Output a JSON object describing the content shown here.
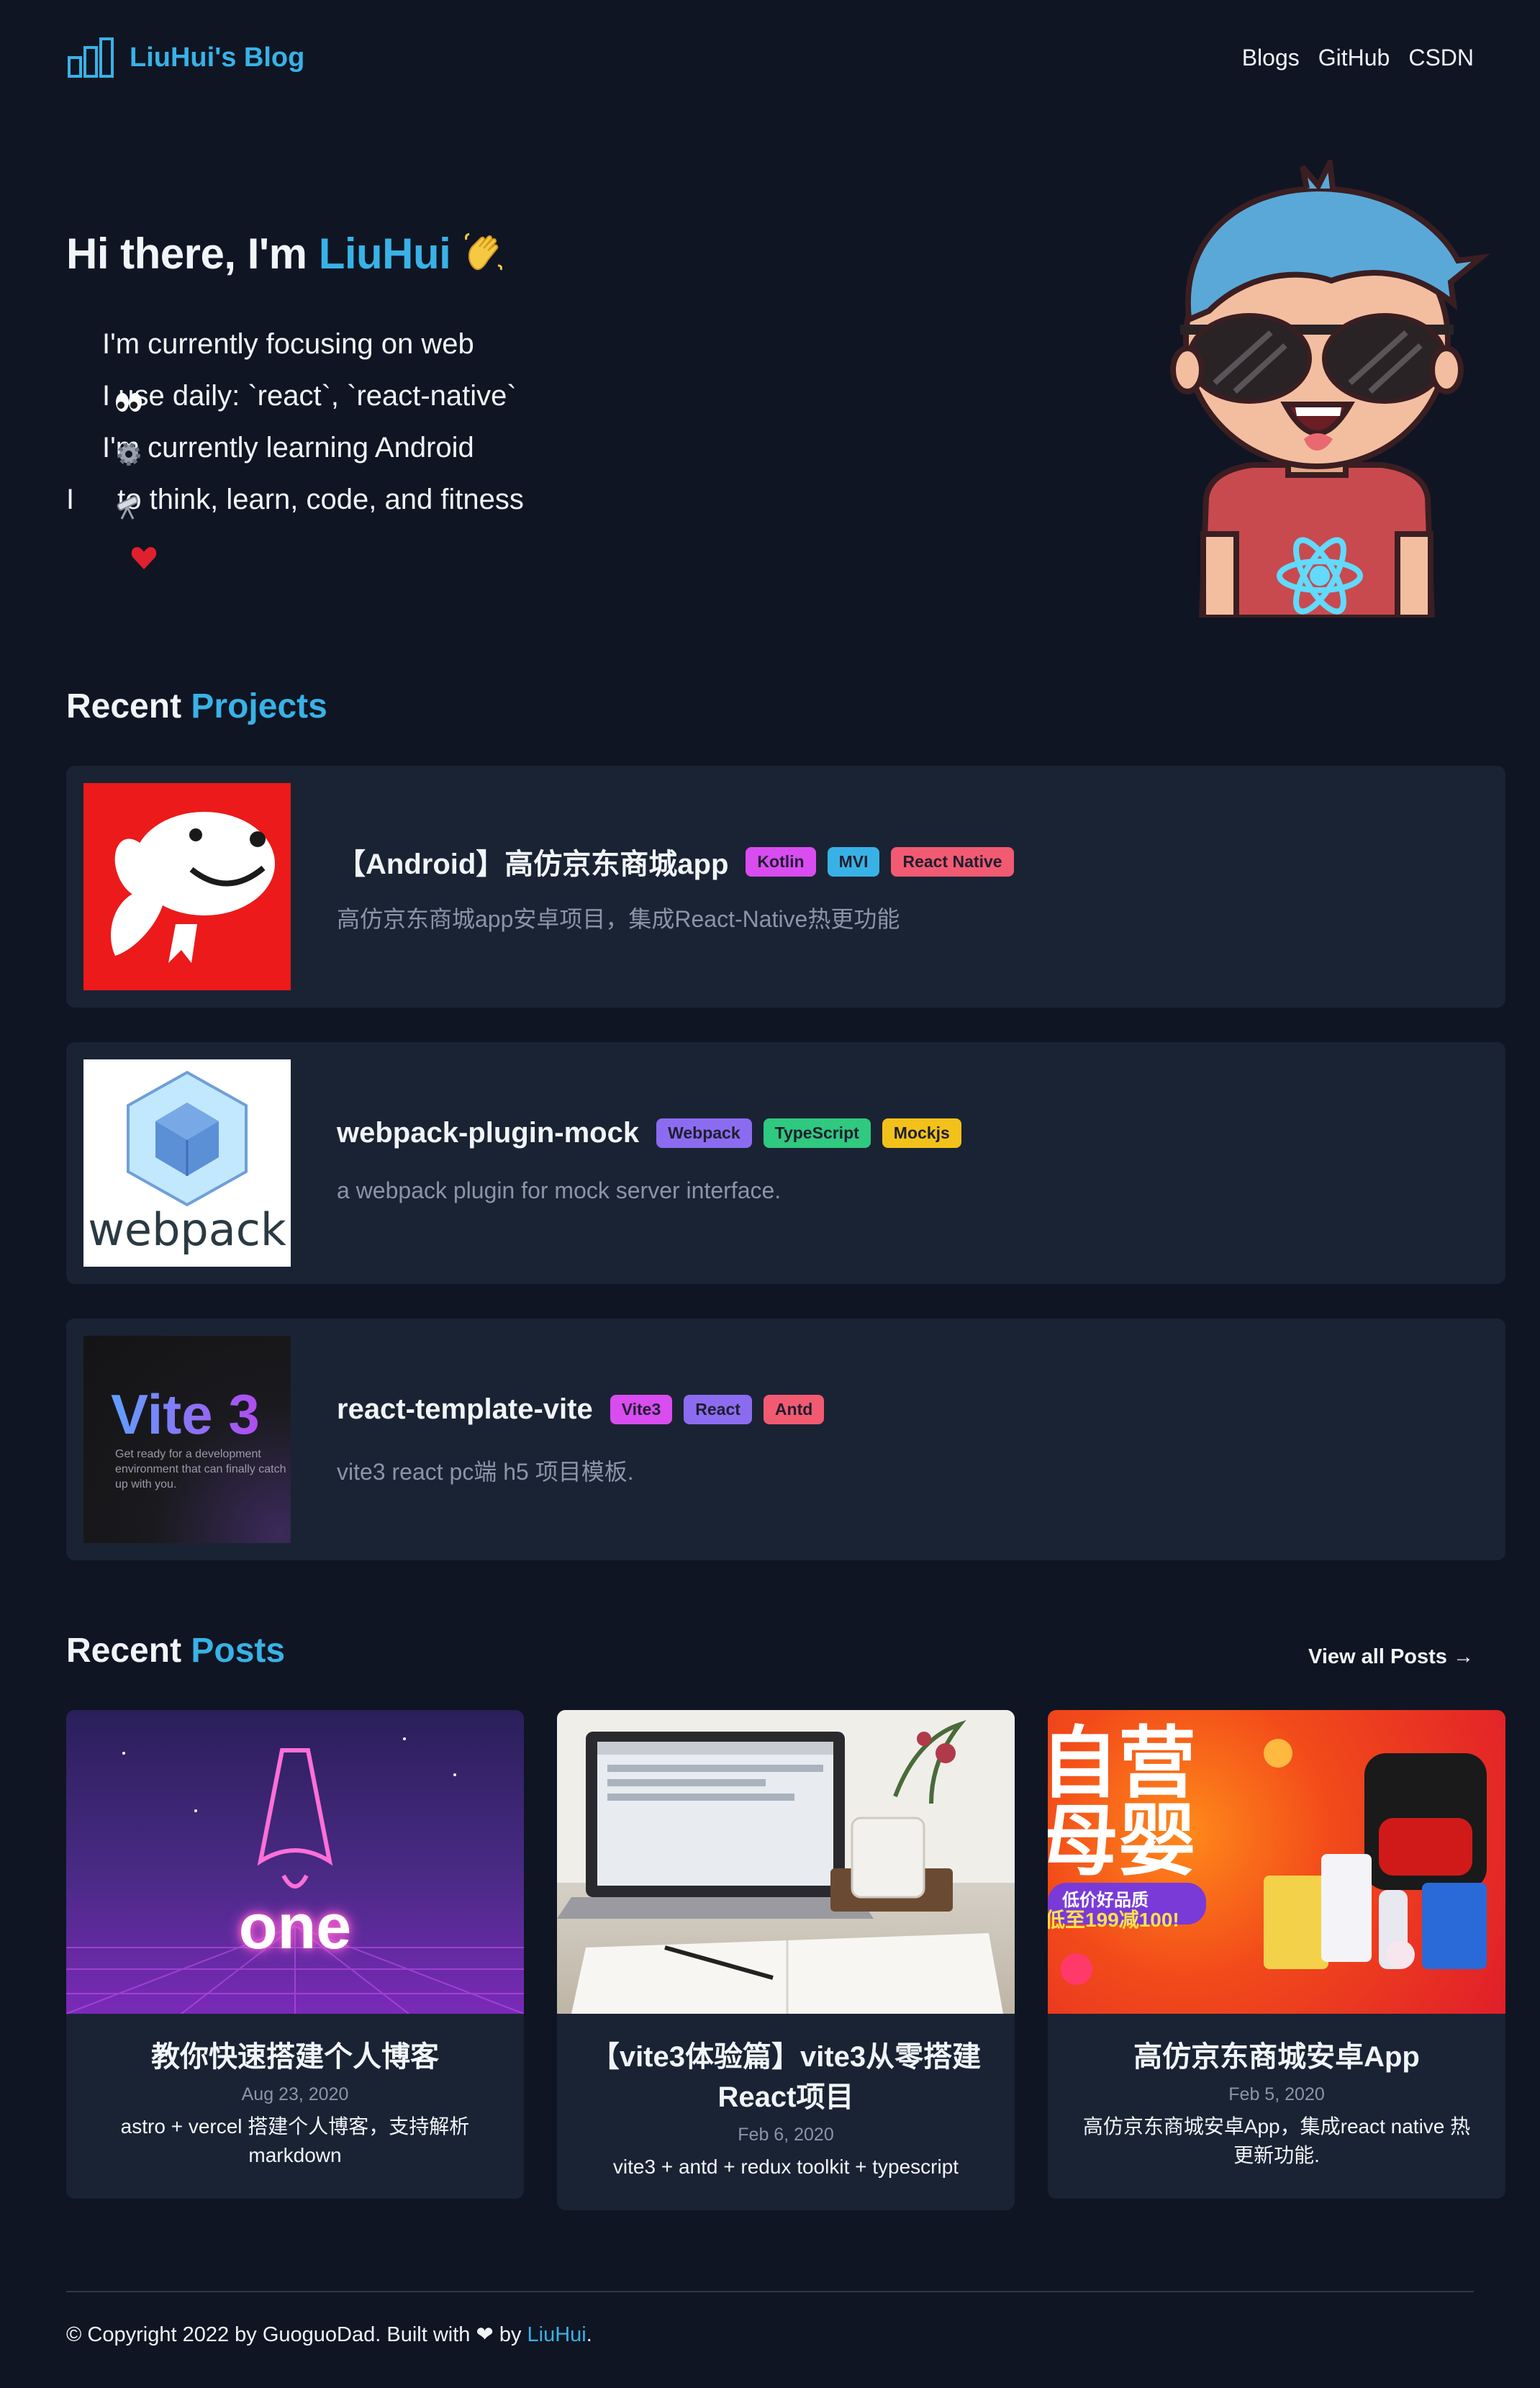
{
  "header": {
    "brand": "LiuHui's Blog",
    "nav": [
      "Blogs",
      "GitHub",
      "CSDN"
    ]
  },
  "hero": {
    "greeting": "Hi there, I'm ",
    "name": "LiuHui",
    "wave_emoji": "👋",
    "lines": [
      {
        "icon": "eyes-emoji",
        "text": "I'm currently focusing on web"
      },
      {
        "icon": "gear-emoji",
        "text": "I use daily: `react`, `react-native`"
      },
      {
        "icon": "telescope-emoji",
        "text": "I'm currently learning Android"
      },
      {
        "prefix": "I",
        "icon": "heart-emoji",
        "text": "to think, learn, code, and fitness"
      }
    ]
  },
  "projects_section": {
    "title_plain": "Recent ",
    "title_accent": "Projects"
  },
  "projects": [
    {
      "title": "【Android】高仿京东商城app",
      "description": "高仿京东商城app安卓项目，集成React-Native热更功能",
      "tags": [
        {
          "label": "Kotlin",
          "color": "#d94cf0"
        },
        {
          "label": "MVI",
          "color": "#38b2e6"
        },
        {
          "label": "React Native",
          "color": "#f25a72"
        }
      ]
    },
    {
      "title": "webpack-plugin-mock",
      "description": "a webpack plugin for mock server interface.",
      "thumb_text": "webpack",
      "tags": [
        {
          "label": "Webpack",
          "color": "#8b6cf0"
        },
        {
          "label": "TypeScript",
          "color": "#2fc97f"
        },
        {
          "label": "Mockjs",
          "color": "#f2c21a"
        }
      ]
    },
    {
      "title": "react-template-vite",
      "description": "vite3 react pc端 h5 项目模板.",
      "thumb_title": "Vite 3",
      "thumb_sub": "Get ready for a development environment that can finally catch up with you.",
      "tags": [
        {
          "label": "Vite3",
          "color": "#d94cf0"
        },
        {
          "label": "React",
          "color": "#8b6cf0"
        },
        {
          "label": "Antd",
          "color": "#f25a72"
        }
      ]
    }
  ],
  "posts_section": {
    "title_plain": "Recent ",
    "title_accent": "Posts",
    "view_all": "View all Posts →"
  },
  "posts": [
    {
      "title": "教你快速搭建个人博客",
      "date": "Aug 23, 2020",
      "description": "astro + vercel 搭建个人博客，支持解析markdown",
      "cover_text": "one"
    },
    {
      "title": "【vite3体验篇】vite3从零搭建React项目",
      "date": "Feb 6, 2020",
      "description": "vite3 + antd + redux toolkit + typescript"
    },
    {
      "title": "高仿京东商城安卓App",
      "date": "Feb 5, 2020",
      "description": "高仿京东商城安卓App，集成react native 热更新功能.",
      "cover_text_1": "自营",
      "cover_text_2": "母婴",
      "cover_badge_1": "低价好品质",
      "cover_badge_2": "低至199减100!"
    }
  ],
  "footer": {
    "text": "© Copyright 2022 by GuoguoDad. Built with ❤ by ",
    "author": "LiuHui",
    "end": "."
  }
}
